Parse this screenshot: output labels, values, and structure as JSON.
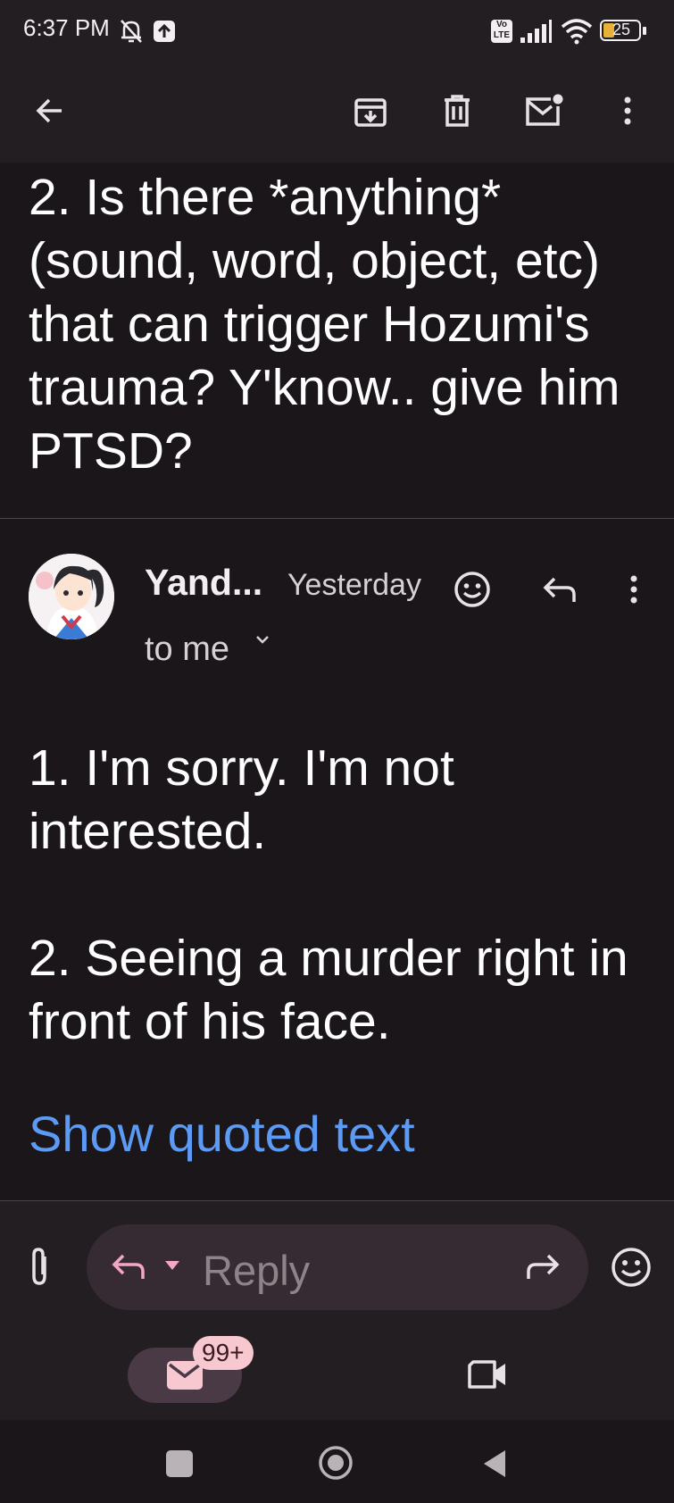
{
  "status_bar": {
    "time": "6:37 PM",
    "network_label": "Vo LTE",
    "battery": "25",
    "icons": [
      "bell-off-icon",
      "upload-icon",
      "volte-icon",
      "signal-icon",
      "wifi-icon",
      "battery-icon"
    ]
  },
  "toolbar": {
    "icons": [
      "back-arrow-icon",
      "archive-icon",
      "delete-icon",
      "mark-unread-icon",
      "more-vert-icon"
    ]
  },
  "previous_message": {
    "text": "2. Is there *anything* (sound, word, object, etc) that can trigger Hozumi's trauma? Y'know.. give him PTSD?"
  },
  "message": {
    "sender": "Yand...",
    "date": "Yesterday",
    "recipient": "to me",
    "body": "1. I'm sorry. I'm not interested.\n\n2. Seeing a murder right in front of his face.",
    "show_quoted": "Show quoted text",
    "header_icons": [
      "emoji-react-icon",
      "reply-icon",
      "more-vert-icon"
    ]
  },
  "reply_bar": {
    "placeholder": "Reply",
    "icons": [
      "attachment-icon",
      "reply-icon",
      "dropdown-icon",
      "forward-icon",
      "emoji-icon"
    ]
  },
  "bottom_nav": {
    "mail_badge": "99+",
    "icons": [
      "mail-icon",
      "meet-video-icon"
    ]
  },
  "colors": {
    "background": "#1b1619",
    "bar_background": "#231e22",
    "link": "#5c9bf5",
    "accent_pink": "#f4a7c4"
  }
}
